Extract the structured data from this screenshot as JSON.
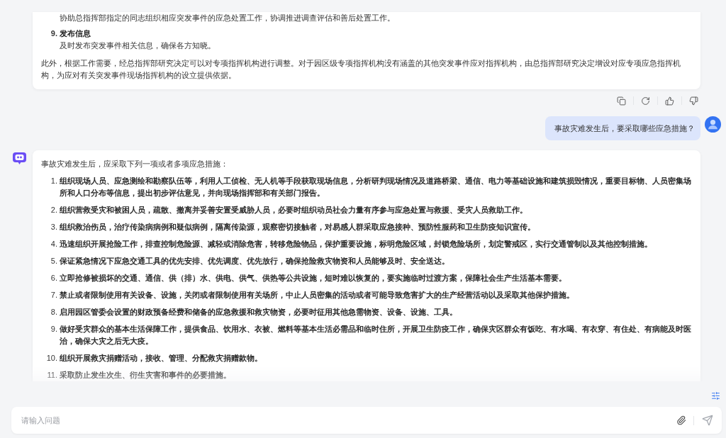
{
  "previous_answer": {
    "items": [
      {
        "description": "协助总指挥部指定的同志组织相应突发事件的应急处置工作，协调推进调查评估和善后处置工作。"
      },
      {
        "number": "9.",
        "title": "发布信息",
        "description": "及时发布突发事件相关信息，确保各方知晓。"
      }
    ],
    "closing": "此外，根据工作需要，经总指挥部研究决定可以对专项指挥机构进行调整。对于园区级专项指挥机构没有涵盖的其他突发事件应对指挥机构，由总指挥部研究决定增设对应专项应急指挥机构，为应对有关突发事件现场指挥机构的设立提供依据。"
  },
  "user_message": {
    "text": "事故灾难发生后，要采取哪些应急措施？"
  },
  "answer": {
    "intro": "事故灾难发生后，应采取下列一项或者多项应急措施：",
    "items": [
      {
        "number": "1.",
        "text": "组织现场人员、应急测绘和勘察队伍等，利用人工侦检、无人机等手段获取现场信息，分析研判现场情况及道路桥梁、通信、电力等基础设施和建筑损毁情况，重要目标物、人员密集场所和人口分布等信息，提出初步评估意见，并向现场指挥部和有关部门报告。"
      },
      {
        "number": "2.",
        "text": "组织营救受灾和被困人员，疏散、撤离并妥善安置受威胁人员，必要时组织动员社会力量有序参与应急处置与救援、受灾人员救助工作。"
      },
      {
        "number": "3.",
        "text": "组织救治伤员，治疗传染病病例和疑似病例，隔离传染源，观察密切接触者，对易感人群采取应急接种、预防性服药和卫生防疫知识宣传。"
      },
      {
        "number": "4.",
        "text": "迅速组织开展抢险工作，排查控制危险源、减轻或消除危害，转移危险物品，保护重要设施，标明危险区域，封锁危险场所，划定警戒区，实行交通管制以及其他控制措施。"
      },
      {
        "number": "5.",
        "text": "保证紧急情况下应急交通工具的优先安排、优先调度、优先放行，确保抢险救灾物资和人员能够及时、安全送达。"
      },
      {
        "number": "6.",
        "text": "立即抢修被损坏的交通、通信、供（排）水、供电、供气、供热等公共设施，短时难以恢复的，要实施临时过渡方案，保障社会生产生活基本需要。"
      },
      {
        "number": "7.",
        "text": "禁止或者限制使用有关设备、设施，关闭或者限制使用有关场所，中止人员密集的活动或者可能导致危害扩大的生产经营活动以及采取其他保护措施。"
      },
      {
        "number": "8.",
        "text": "启用园区管委会设置的财政预备经费和储备的应急救援和救灾物资，必要时征用其他急需物资、设备、设施、工具。"
      },
      {
        "number": "9.",
        "text": "做好受灾群众的基本生活保障工作，提供食品、饮用水、衣被、燃料等基本生活必需品和临时住所，开展卫生防疫工作，确保灾区群众有饭吃、有水喝、有衣穿、有住处、有病能及时医治，确保大灾之后无大疫。"
      },
      {
        "number": "10.",
        "text": "组织开展救灾捐赠活动，接收、管理、分配救灾捐赠款物。"
      },
      {
        "number": "11.",
        "text": "采取防止发生次生、衍生灾害和事件的必要措施。"
      }
    ]
  },
  "input": {
    "placeholder": "请输入问题"
  }
}
